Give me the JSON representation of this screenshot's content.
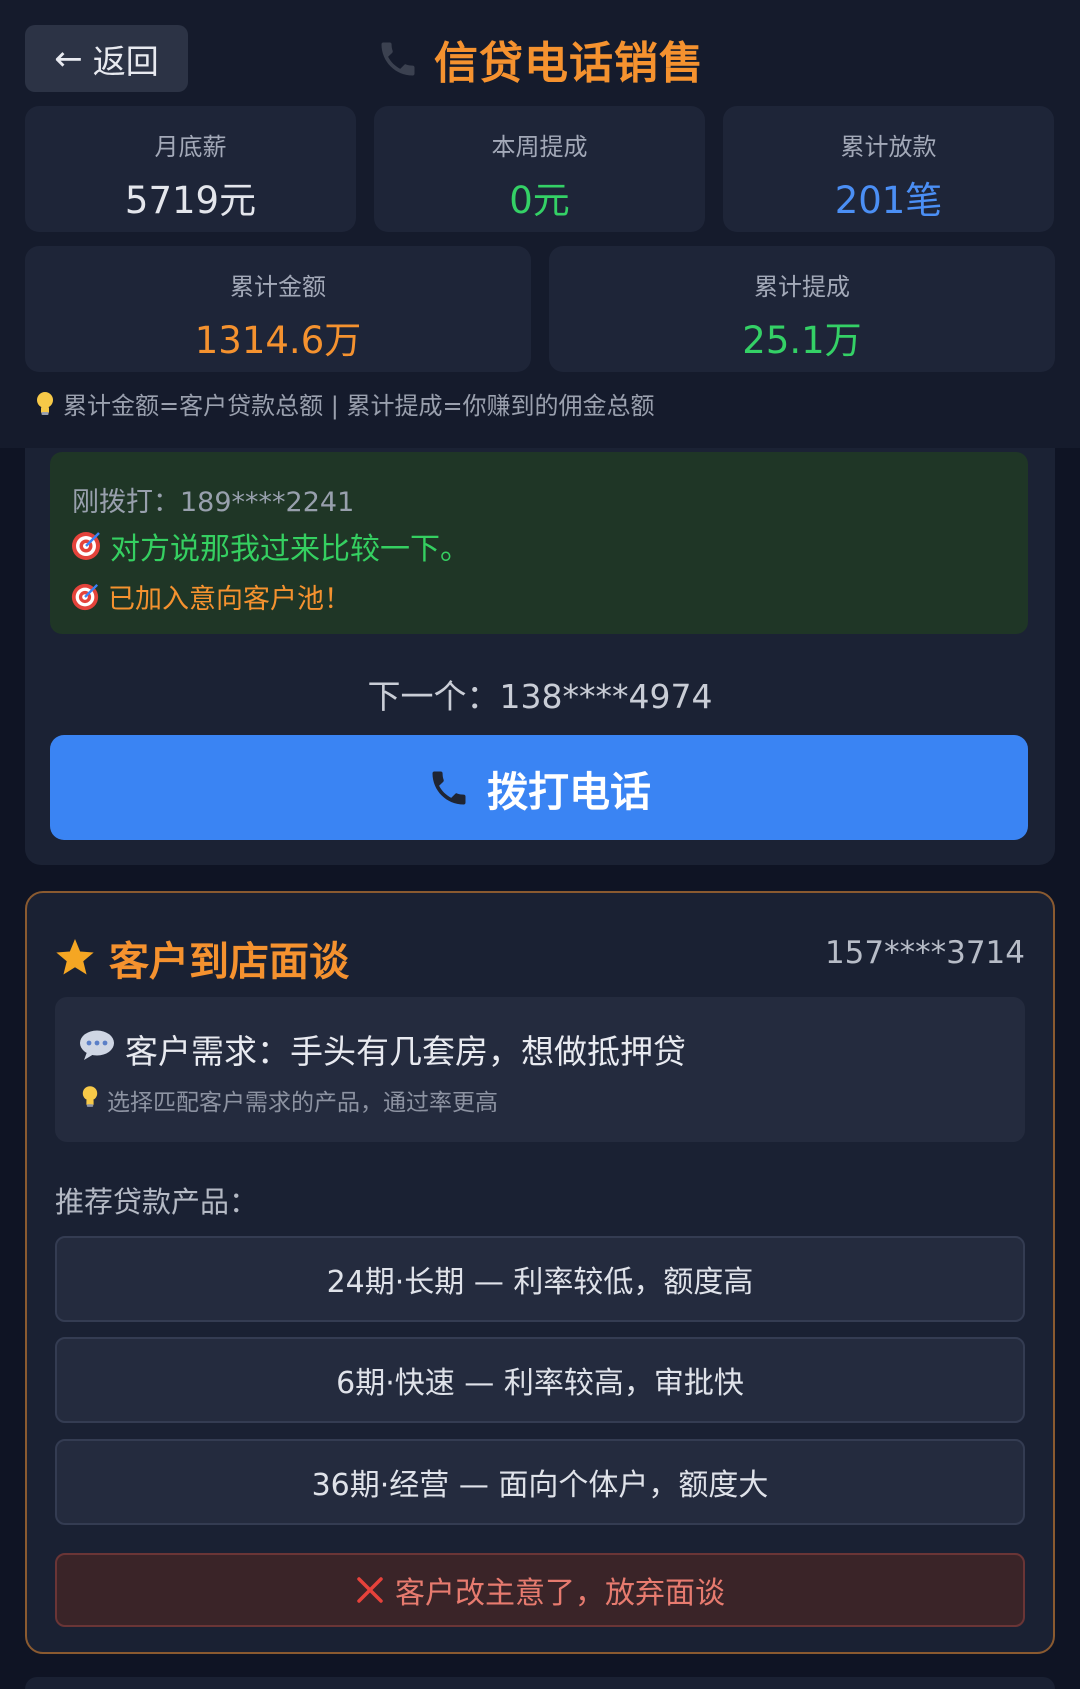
{
  "header": {
    "back_label": "返回",
    "title": "信贷电话销售",
    "title_icon": "phone-icon",
    "stats_row1": [
      {
        "label": "月底薪",
        "value": "5719元",
        "color": "#e4e6ec"
      },
      {
        "label": "本周提成",
        "value": "0元",
        "color": "#34d166"
      },
      {
        "label": "累计放款",
        "value": "201笔",
        "color": "#4b8ff5"
      }
    ],
    "stats_row2": [
      {
        "label": "累计金额",
        "value": "1314.6万",
        "color": "#f5922f"
      },
      {
        "label": "累计提成",
        "value": "25.1万",
        "color": "#34d166"
      }
    ],
    "tip": "累计金额=客户贷款总额 | 累计提成=你赚到的佣金总额",
    "tip_icon": "lightbulb-icon"
  },
  "call": {
    "dialed": "刚拨打：189****2241",
    "result_line1": "对方说那我过来比较一下。",
    "result_line2": "已加入意向客户池！",
    "result_icon": "target-icon",
    "next": "下一个：138****4974",
    "dial_label": "拨打电话",
    "dial_icon": "phone-icon"
  },
  "store": {
    "title": "客户到店面谈",
    "title_icon": "star-icon",
    "phone": "157****3714",
    "demand": "客户需求：手头有几套房，想做抵押贷",
    "demand_icon": "speech-bubble-icon",
    "demand_tip": "选择匹配客户需求的产品，通过率更高",
    "products_heading": "推荐贷款产品：",
    "products": [
      "24期·长期 — 利率较低，额度高",
      "6期·快速 — 利率较高，审批快",
      "36期·经营 — 面向个体户，额度大"
    ],
    "abandon_label": "客户改主意了，放弃面谈",
    "abandon_icon": "cross-icon"
  },
  "colors": {
    "accent_orange": "#f5922f",
    "success_green": "#34d166",
    "primary_blue": "#3a84f3",
    "danger_red": "#e77b6f"
  }
}
